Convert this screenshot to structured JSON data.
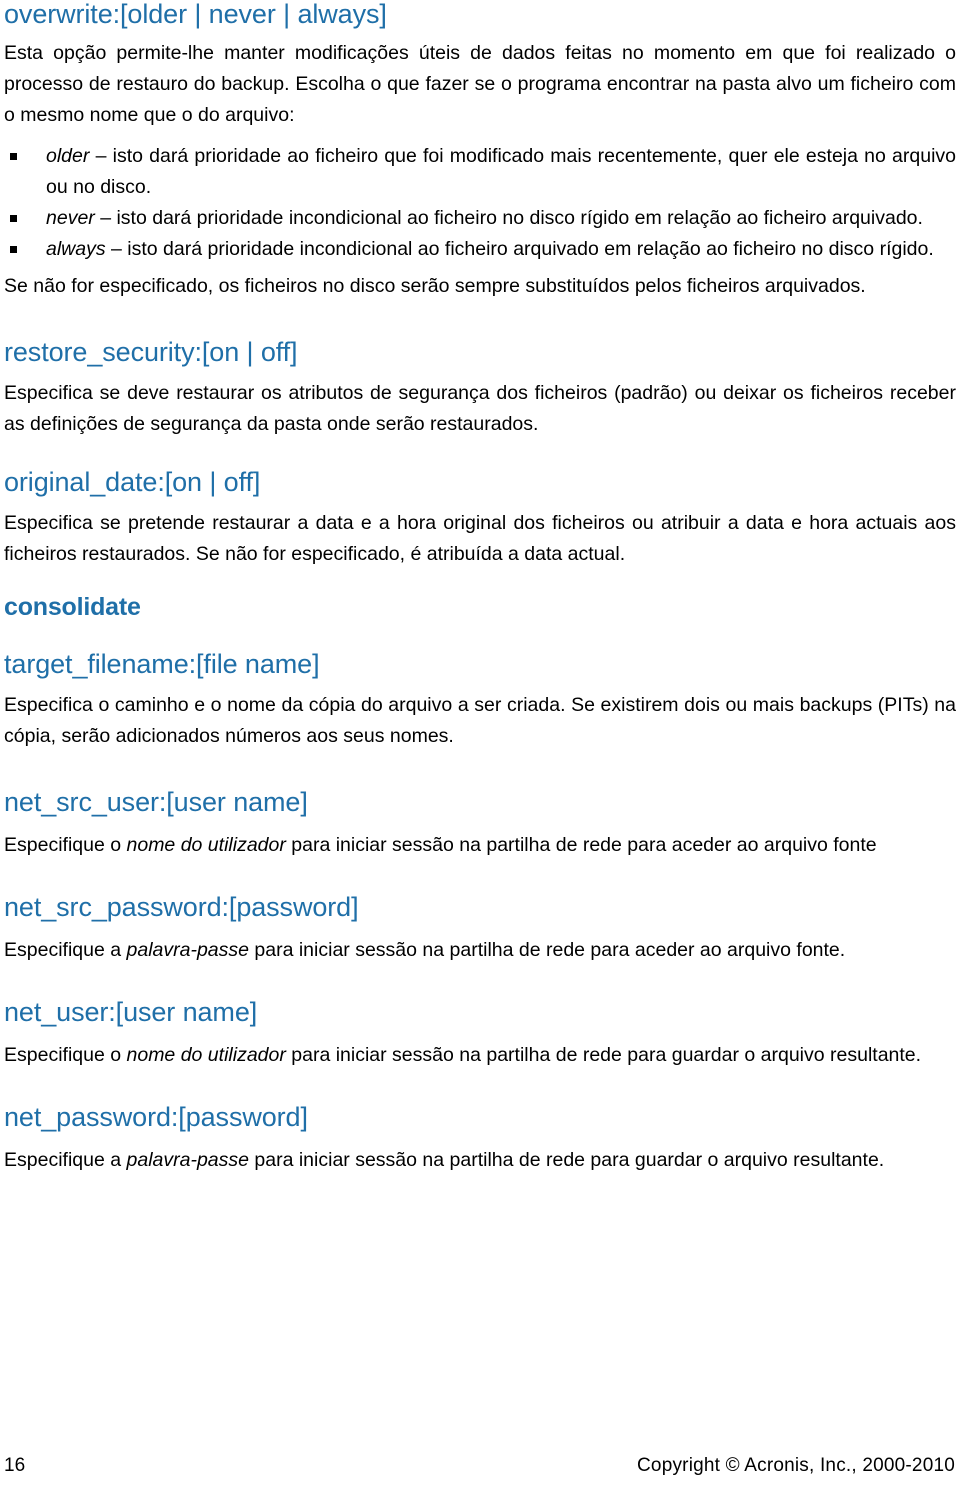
{
  "page": {
    "language": "pt-PT",
    "accent_color": "#1F6FA8",
    "text_color": "#000000",
    "background_color": "#FFFFFF"
  },
  "sections": {
    "overwrite": {
      "heading": "overwrite:[older | never | always]",
      "intro": "Esta opção permite-lhe manter modificações úteis de dados feitas no momento em que foi realizado o processo de restauro do backup. Escolha o que fazer se o programa encontrar na pasta alvo um ficheiro com o mesmo nome que o do arquivo:",
      "bullets": [
        {
          "term": "older",
          "dash": " – ",
          "text": "isto dará prioridade ao ficheiro que foi modificado mais recentemente, quer ele esteja no arquivo ou no disco."
        },
        {
          "term": "never",
          "dash": " – ",
          "text": "isto dará prioridade incondicional ao ficheiro no disco rígido em relação ao ficheiro arquivado."
        },
        {
          "term": "always",
          "dash": " – ",
          "text": "isto dará prioridade incondicional ao ficheiro arquivado em relação ao ficheiro no disco rígido."
        }
      ],
      "closing": "Se não for especificado, os ficheiros no disco serão sempre substituídos pelos ficheiros arquivados."
    },
    "restore_security": {
      "heading": "restore_security:[on | off]",
      "body": "Especifica se deve restaurar os atributos de segurança dos ficheiros (padrão) ou deixar os ficheiros receber as definições de segurança da pasta onde serão restaurados."
    },
    "original_date": {
      "heading": "original_date:[on | off]",
      "body": "Especifica se pretende restaurar a data e a hora original dos ficheiros ou atribuir a data e hora actuais aos ficheiros restaurados. Se não for especificado, é atribuída a data actual."
    },
    "consolidate": {
      "heading": "consolidate"
    },
    "target_filename": {
      "heading": "target_filename:[file name]",
      "body": "Especifica o caminho e o nome da cópia do arquivo a ser criada. Se existirem dois ou mais backups (PITs) na cópia, serão adicionados números aos seus nomes."
    },
    "net_src_user": {
      "heading": "net_src_user:[user name]",
      "body_before": "Especifique o ",
      "body_emphasis": "nome do utilizador",
      "body_after": " para iniciar sessão na partilha de rede para aceder ao arquivo fonte"
    },
    "net_src_password": {
      "heading": "net_src_password:[password]",
      "body_before": "Especifique a ",
      "body_emphasis": "palavra-passe",
      "body_after": " para iniciar sessão na partilha de rede para aceder ao arquivo fonte."
    },
    "net_user": {
      "heading": "net_user:[user name]",
      "body_before": "Especifique o ",
      "body_emphasis": "nome do utilizador",
      "body_after": " para iniciar sessão na partilha de rede para guardar o arquivo resultante."
    },
    "net_password": {
      "heading": "net_password:[password]",
      "body_before": "Especifique a ",
      "body_emphasis": "palavra-passe",
      "body_after": " para iniciar sessão na partilha de rede para guardar o arquivo resultante."
    }
  },
  "footer": {
    "page_number": "16",
    "copyright": "Copyright © Acronis, Inc., 2000-2010"
  }
}
